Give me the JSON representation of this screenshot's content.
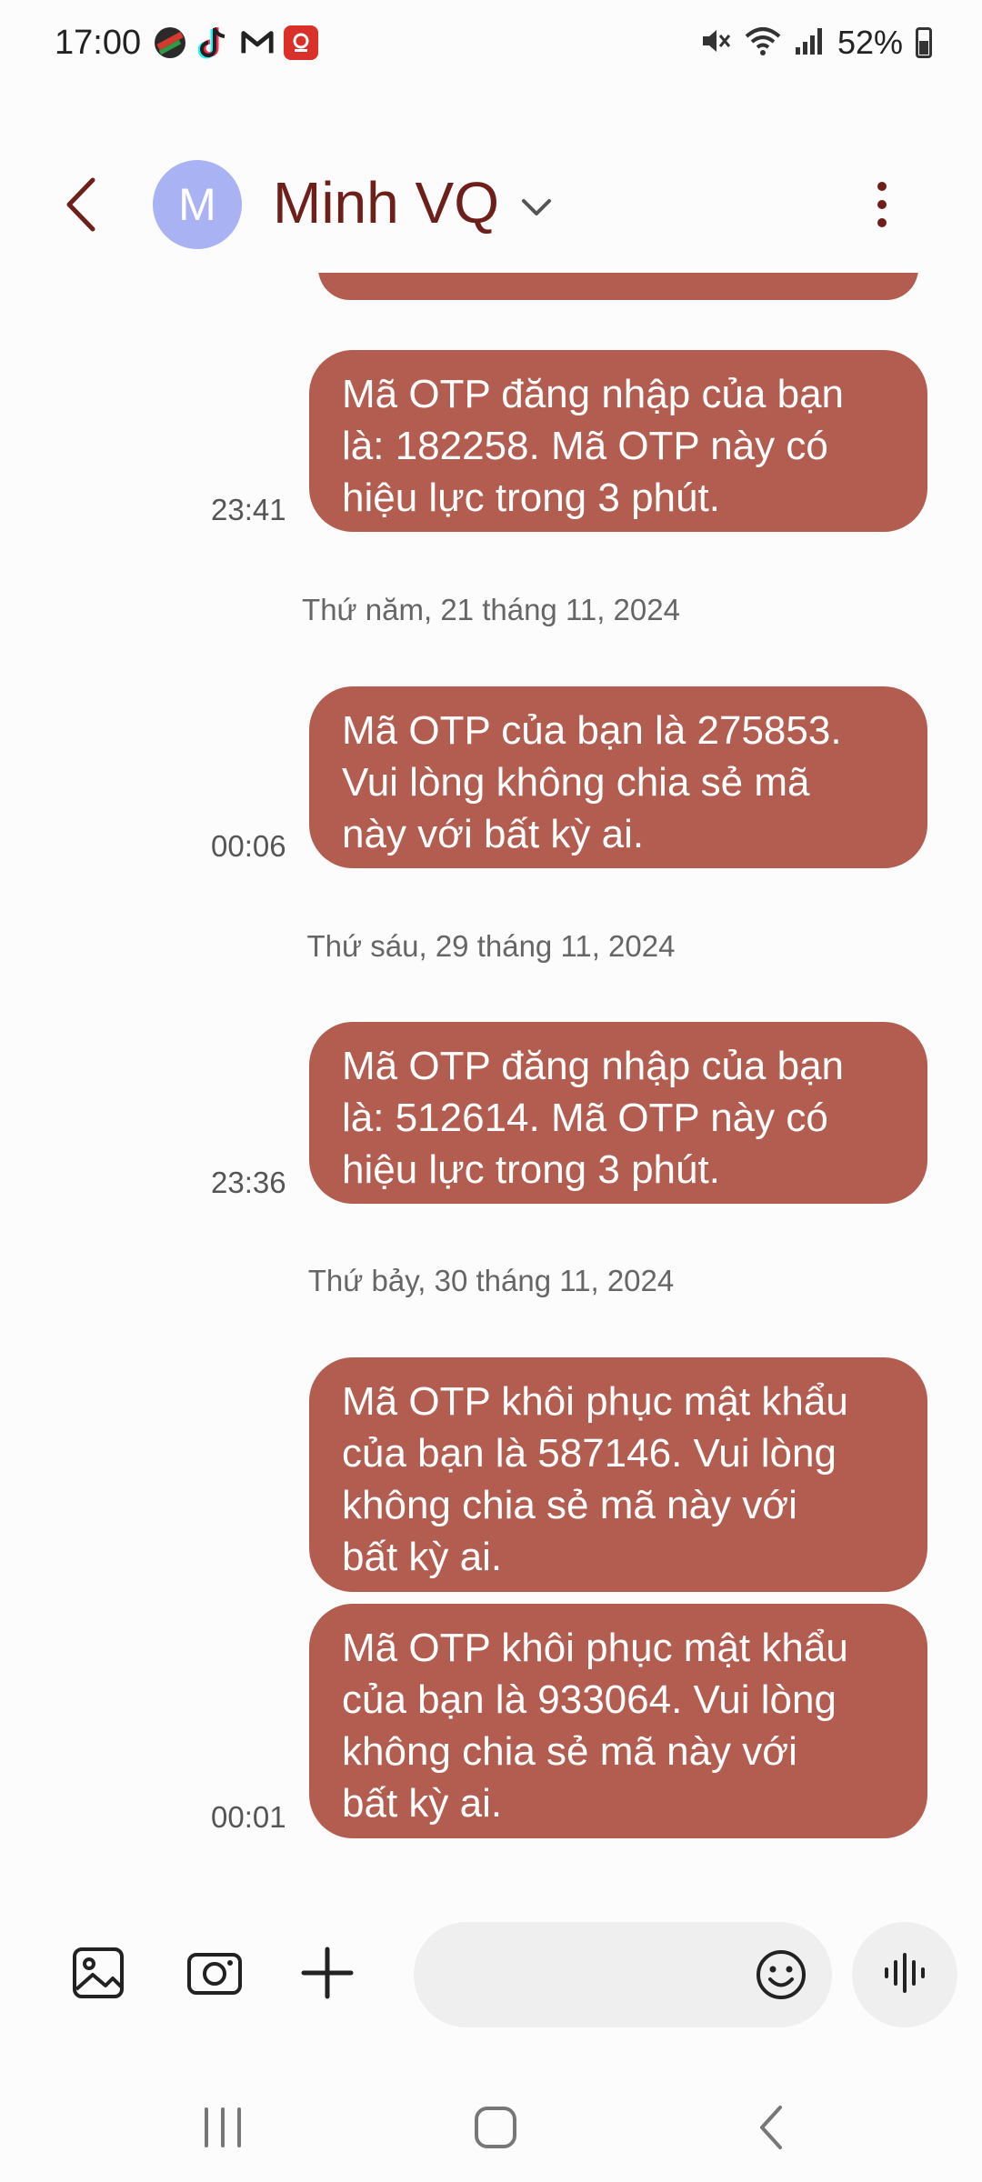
{
  "status_bar": {
    "time": "17:00",
    "battery": "52%",
    "notification_icons": [
      "ball-app-icon",
      "tiktok-icon",
      "gmail-icon",
      "red-app-icon"
    ],
    "system_icons": [
      "mute-icon",
      "wifi-icon",
      "signal-icon",
      "battery-icon"
    ]
  },
  "header": {
    "avatar_letter": "M",
    "contact_name": "Minh VQ",
    "avatar_color": "#a9b2f2",
    "name_color": "#6e1f1a"
  },
  "conversation": {
    "bubble_color": "#b35d50",
    "groups": [
      {
        "date": "",
        "messages": [
          {
            "text_lines": [
              "Mã OTP đăng nhập của bạn",
              "là: 182258. Mã OTP này có",
              "hiệu lực trong 3 phút."
            ],
            "time": "23:41"
          }
        ]
      },
      {
        "date": "Thứ năm, 21 tháng 11, 2024",
        "messages": [
          {
            "text_lines": [
              "Mã OTP của bạn là 275853.",
              "Vui lòng không chia sẻ mã",
              "này với bất kỳ ai."
            ],
            "time": "00:06"
          }
        ]
      },
      {
        "date": "Thứ sáu, 29 tháng 11, 2024",
        "messages": [
          {
            "text_lines": [
              "Mã OTP đăng nhập của bạn",
              "là: 512614. Mã OTP này có",
              "hiệu lực trong 3 phút."
            ],
            "time": "23:36"
          }
        ]
      },
      {
        "date": "Thứ bảy, 30 tháng 11, 2024",
        "messages": [
          {
            "text_lines": [
              "Mã OTP khôi phục mật khẩu",
              "của bạn là 587146. Vui lòng",
              "không chia sẻ mã này với",
              "bất kỳ ai."
            ],
            "time": ""
          },
          {
            "text_lines": [
              "Mã OTP khôi phục mật khẩu",
              "của bạn là 933064. Vui lòng",
              "không chia sẻ mã này với",
              "bất kỳ ai."
            ],
            "time": "00:01"
          }
        ]
      }
    ]
  },
  "composer": {
    "tools": [
      "gallery-icon",
      "camera-icon",
      "add-icon"
    ],
    "input_placeholder": "",
    "emoji": "emoji-icon",
    "voice": "voice-record-icon"
  },
  "nav_bar": {
    "buttons": [
      "recent-apps-icon",
      "home-icon",
      "back-nav-icon"
    ]
  }
}
